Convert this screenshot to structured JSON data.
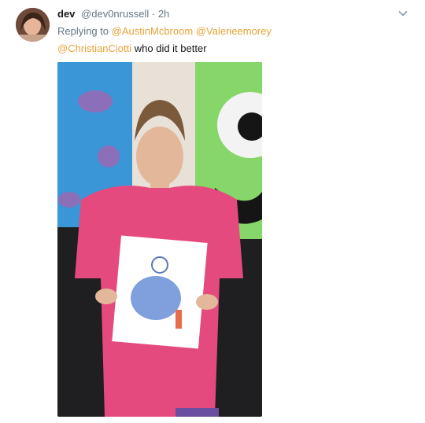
{
  "tweet": {
    "display_name": "dev",
    "handle": "@dev0nrussell",
    "separator": "·",
    "time": "2h",
    "replying_label": "Replying to",
    "mentions_line1": [
      "@AustinMcbroom",
      "@Valerieemorey"
    ],
    "mention_line2": "@ChristianCiotti",
    "text": "who did it better",
    "menu_icon": "chevron-down-icon",
    "avatar_icon": "avatar"
  },
  "colors": {
    "mention": "#e8a33a",
    "meta": "#657786",
    "text": "#14171a"
  }
}
